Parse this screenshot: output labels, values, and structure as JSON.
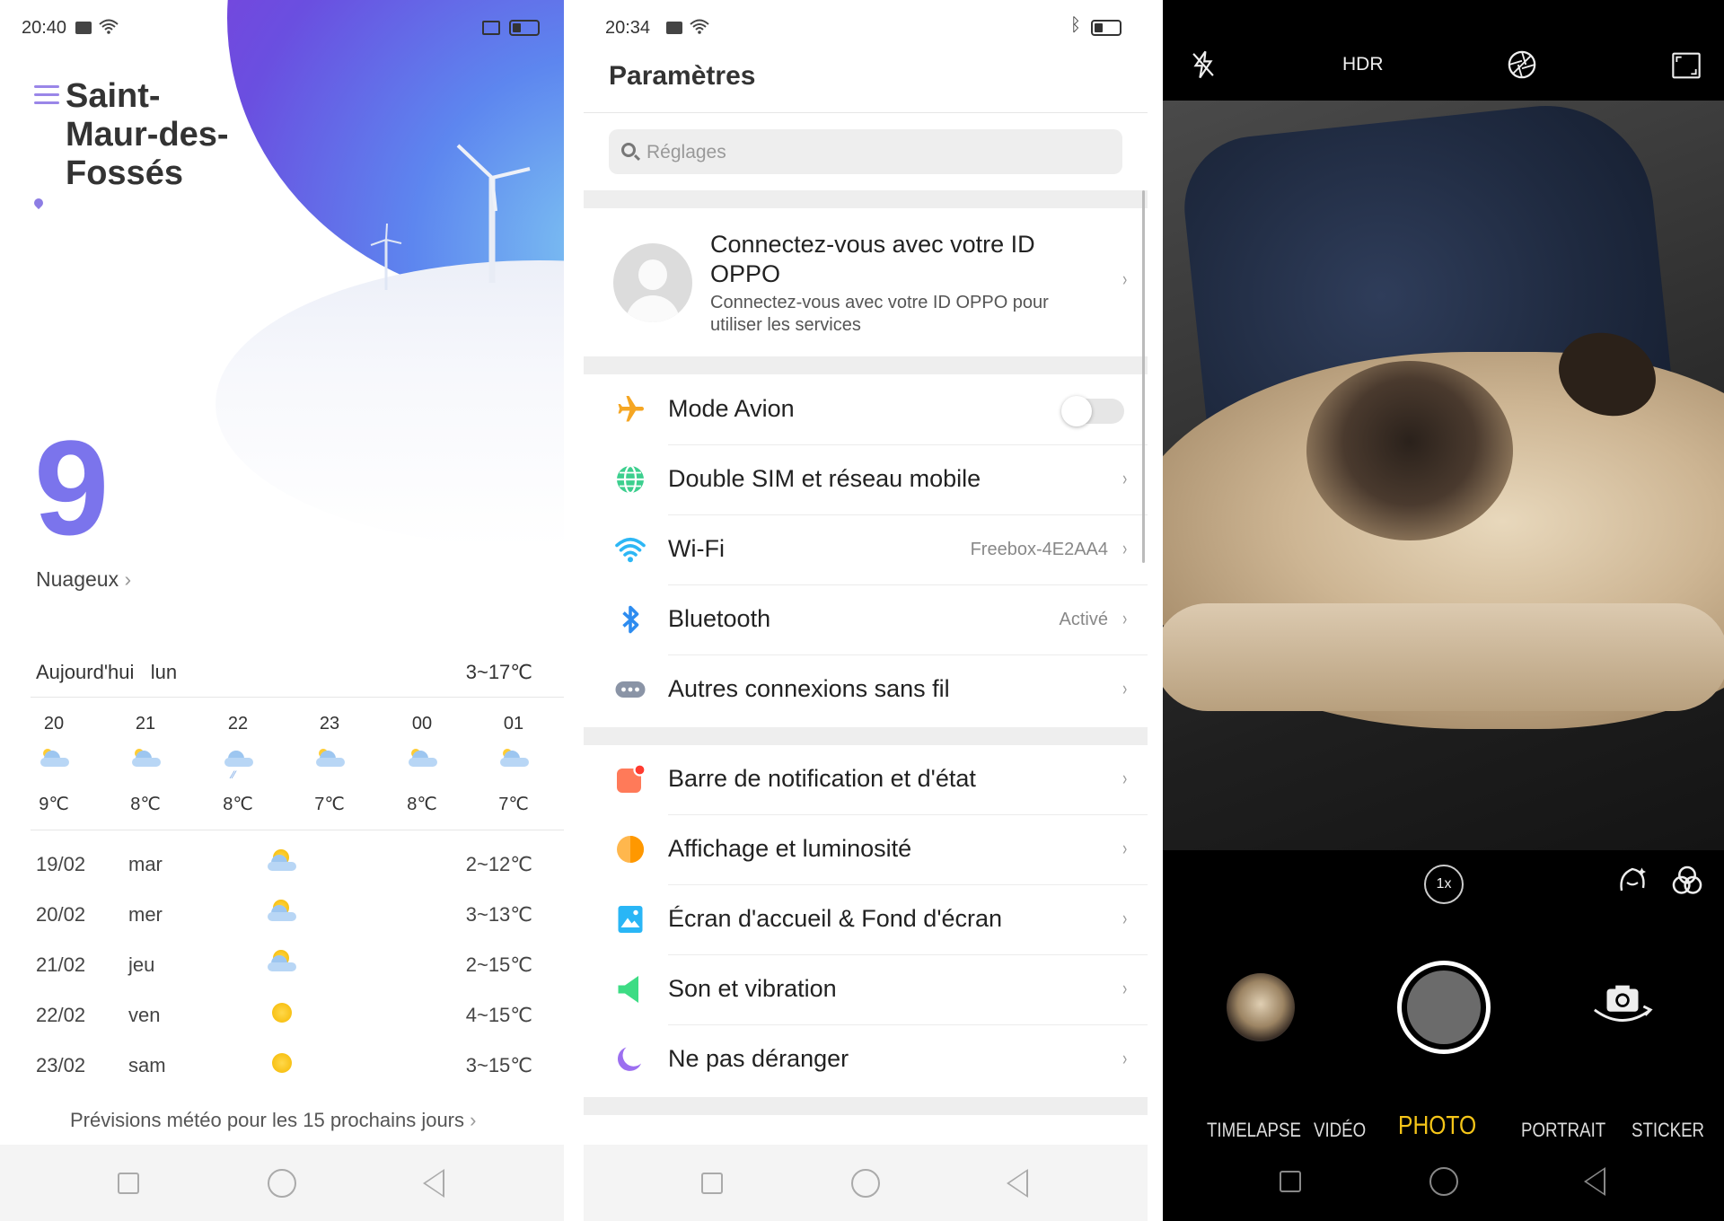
{
  "weather": {
    "status_time": "20:40",
    "city": "Saint-Maur-des-Fossés",
    "current_temp": "9",
    "condition": "Nuageux",
    "today_label": "Aujourd'hui",
    "today_day": "lun",
    "today_range": "3~17℃",
    "hours": [
      {
        "time": "20",
        "temp": "9℃",
        "icon": "partly-cloudy-night-icon"
      },
      {
        "time": "21",
        "temp": "8℃",
        "icon": "partly-cloudy-night-icon"
      },
      {
        "time": "22",
        "temp": "8℃",
        "icon": "rain-cloud-icon"
      },
      {
        "time": "23",
        "temp": "7℃",
        "icon": "partly-cloudy-night-icon"
      },
      {
        "time": "00",
        "temp": "8℃",
        "icon": "partly-cloudy-night-icon"
      },
      {
        "time": "01",
        "temp": "7℃",
        "icon": "partly-cloudy-night-icon"
      }
    ],
    "days": [
      {
        "date": "19/02",
        "day": "mar",
        "range": "2~12℃",
        "icon": "partly-cloudy-icon"
      },
      {
        "date": "20/02",
        "day": "mer",
        "range": "3~13℃",
        "icon": "partly-cloudy-icon"
      },
      {
        "date": "21/02",
        "day": "jeu",
        "range": "2~15℃",
        "icon": "partly-cloudy-icon"
      },
      {
        "date": "22/02",
        "day": "ven",
        "range": "4~15℃",
        "icon": "sun-icon"
      },
      {
        "date": "23/02",
        "day": "sam",
        "range": "3~15℃",
        "icon": "sun-icon"
      }
    ],
    "forecast_link": "Prévisions météo pour les 15 prochains jours"
  },
  "settings": {
    "status_time": "20:34",
    "title": "Paramètres",
    "search_placeholder": "Réglages",
    "account_title": "Connectez-vous avec votre ID OPPO",
    "account_subtitle": "Connectez-vous avec votre ID OPPO pour utiliser les services",
    "items": [
      {
        "label": "Mode Avion",
        "value": "",
        "icon": "airplane-icon",
        "color": "#f5a623",
        "toggle": true
      },
      {
        "label": "Double SIM et réseau mobile",
        "value": "",
        "icon": "globe-icon",
        "color": "#3ccf8e"
      },
      {
        "label": "Wi-Fi",
        "value": "Freebox-4E2AA4",
        "icon": "wifi-icon",
        "color": "#2db7f5"
      },
      {
        "label": "Bluetooth",
        "value": "Activé",
        "icon": "bluetooth-icon",
        "color": "#2d8cf0"
      },
      {
        "label": "Autres connexions sans fil",
        "value": "",
        "icon": "more-connections-icon",
        "color": "#8a94a6"
      },
      {
        "label": "Barre de notification et d'état",
        "value": "",
        "icon": "notification-bar-icon",
        "color": "#ff6b4a"
      },
      {
        "label": "Affichage et luminosité",
        "value": "",
        "icon": "brightness-icon",
        "color": "#ffa726"
      },
      {
        "label": "Écran d'accueil & Fond d'écran",
        "value": "",
        "icon": "wallpaper-icon",
        "color": "#29b6f6"
      },
      {
        "label": "Son et vibration",
        "value": "",
        "icon": "speaker-icon",
        "color": "#3ddc84"
      },
      {
        "label": "Ne pas déranger",
        "value": "",
        "icon": "moon-icon",
        "color": "#9c6ff0"
      }
    ]
  },
  "camera": {
    "hdr_label": "HDR",
    "zoom": "1x",
    "modes": [
      "TIMELAPSE",
      "VIDÉO",
      "PHOTO",
      "PORTRAIT",
      "STICKER"
    ],
    "active_mode": "PHOTO",
    "accent": "#f5c518"
  }
}
